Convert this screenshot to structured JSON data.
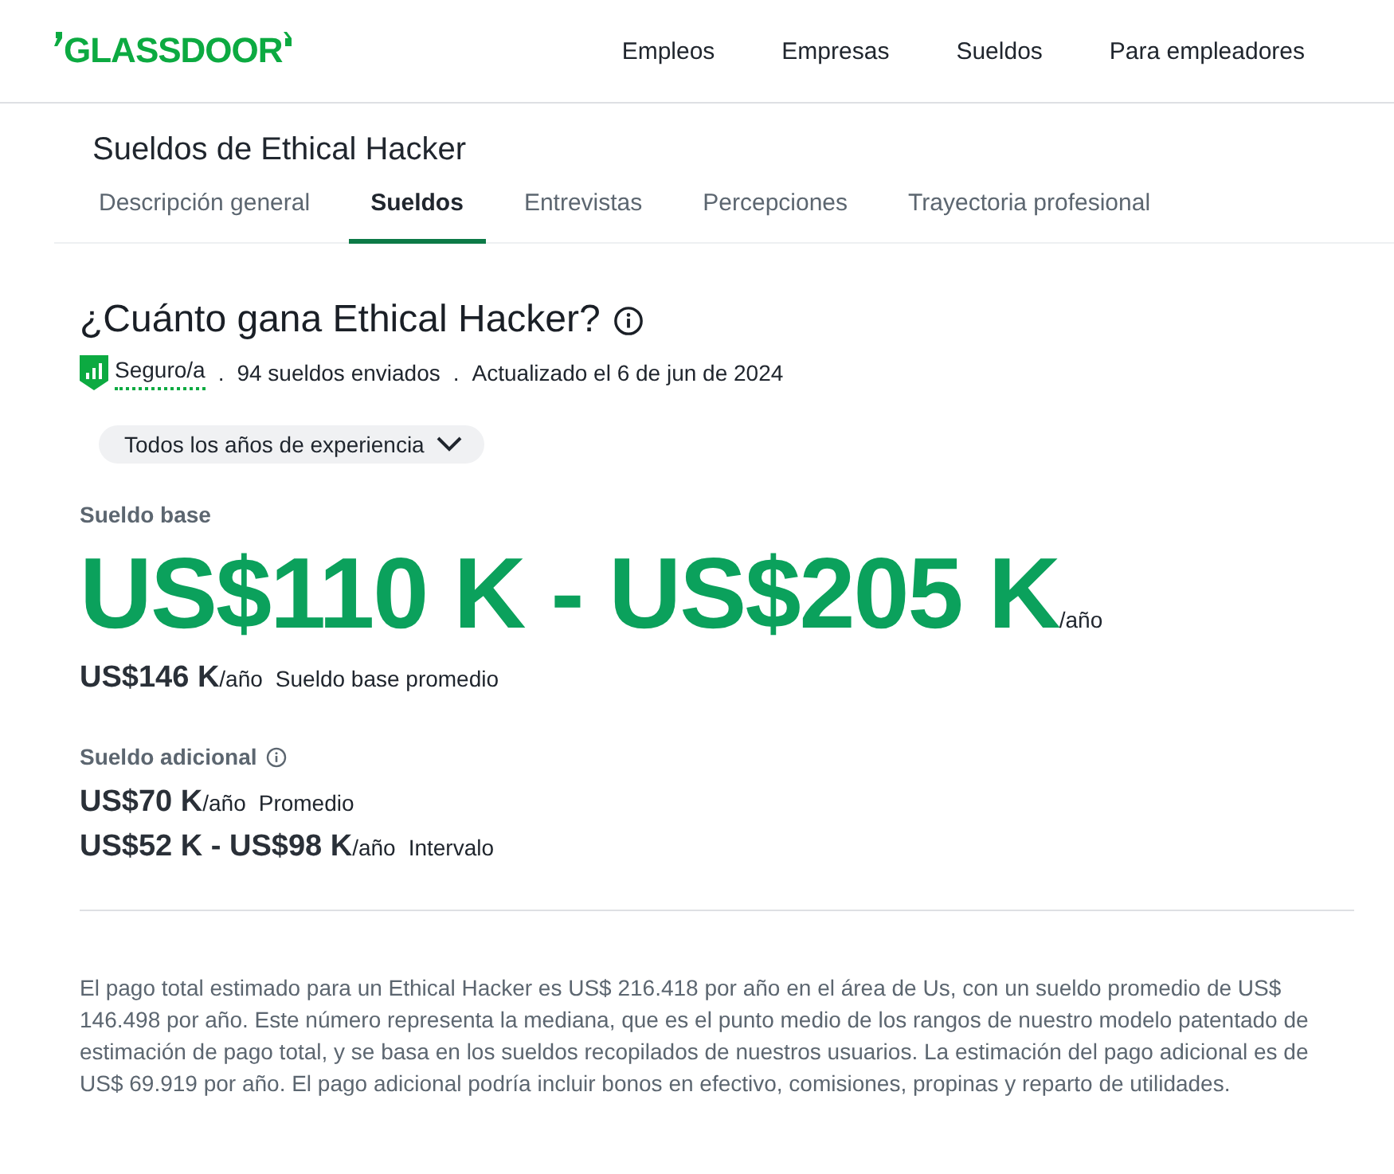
{
  "logo": {
    "text": "GLASSDOOR"
  },
  "nav": [
    "Empleos",
    "Empresas",
    "Sueldos",
    "Para empleadores"
  ],
  "page_title": "Sueldos de Ethical Hacker",
  "tabs": [
    {
      "label": "Descripción general",
      "selected": false
    },
    {
      "label": "Sueldos",
      "selected": true
    },
    {
      "label": "Entrevistas",
      "selected": false
    },
    {
      "label": "Percepciones",
      "selected": false
    },
    {
      "label": "Trayectoria profesional",
      "selected": false
    }
  ],
  "heading": "¿Cuánto gana Ethical Hacker?",
  "meta": {
    "confidence": "Seguro/a",
    "separator": ".",
    "submitted": "94 sueldos enviados",
    "updated": "Actualizado el 6 de jun de 2024"
  },
  "filter": {
    "label": "Todos los años de experiencia"
  },
  "base": {
    "label": "Sueldo base",
    "range": "US$110 K - US$205 K",
    "unit": "/año",
    "average": "US$146 K",
    "average_unit": "/año",
    "average_label": "Sueldo base promedio"
  },
  "additional": {
    "label": "Sueldo adicional",
    "rows": [
      {
        "amount": "US$70 K",
        "unit": "/año",
        "caption": "Promedio"
      },
      {
        "amount": "US$52 K - US$98 K",
        "unit": "/año",
        "caption": "Intervalo"
      }
    ]
  },
  "description": "El pago total estimado para un Ethical Hacker es US$ 216.418 por año en el área de Us, con un sueldo promedio de US$ 146.498 por año. Este número representa la mediana, que es el punto medio de los rangos de nuestro modelo patentado de estimación de pago total, y se basa en los sueldos recopilados de nuestros usuarios. La estimación del pago adicional es de US$ 69.919 por año. El pago adicional podría incluir bonos en efectivo, comisiones, propinas y reparto de utilidades."
}
